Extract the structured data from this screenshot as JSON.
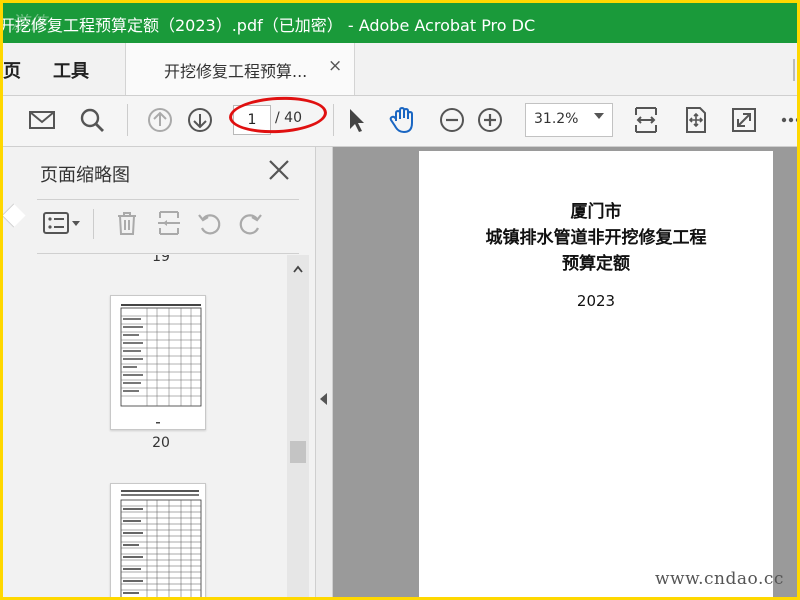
{
  "window": {
    "title": "开挖修复工程预算定额（2023）.pdf（已加密） - Adobe Acrobat Pro DC",
    "watermark_logo": "游侠网"
  },
  "menu": {
    "home_label": "页",
    "tools_label": "工具"
  },
  "tab": {
    "label": "开挖修复工程预算...",
    "close_glyph": "×"
  },
  "toolbar": {
    "current_page": "1",
    "total_pages": "/ 40",
    "zoom": "31.2%",
    "icons": [
      "mail-icon",
      "search-icon",
      "page-up-icon",
      "page-down-icon",
      "select-arrow-icon",
      "hand-icon",
      "zoom-out-icon",
      "zoom-in-icon",
      "fit-width-icon",
      "fit-page-icon",
      "fullscreen-icon",
      "more-icon"
    ]
  },
  "thumbnails_panel": {
    "title": "页面缩略图",
    "pages": [
      {
        "label": "19"
      },
      {
        "label": "20"
      }
    ]
  },
  "document": {
    "heading_lines": [
      "厦门市",
      "城镇排水管道非开挖修复工程",
      "预算定额"
    ],
    "year": "2023"
  },
  "site_watermark": "www.cndao.cc",
  "colors": {
    "titlebar": "#1a9a3a",
    "border": "#ffd800",
    "annotation": "#e01010",
    "hand_tool": "#1a66c2"
  }
}
